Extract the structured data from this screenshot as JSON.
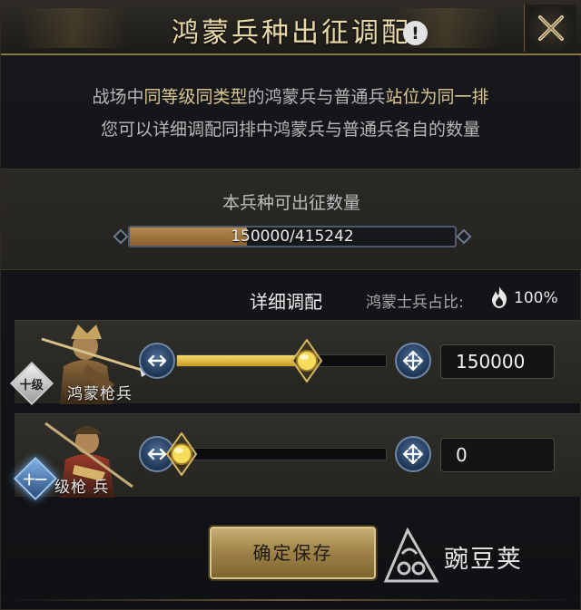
{
  "header": {
    "title": "鸿蒙兵种出征调配"
  },
  "info": {
    "line1": {
      "a": "战场中",
      "b": "同等级同类型",
      "c": "的鸿蒙兵与普通兵",
      "d": "站位为同一排"
    },
    "line2": "您可以详细调配同排中鸿蒙兵与普通兵各自的数量"
  },
  "quantity": {
    "label": "本兵种可出征数量",
    "text": "150000/415242",
    "current": 150000,
    "max": 415242
  },
  "detail": {
    "title": "详细调配",
    "ratio_label": "鸿蒙士兵占比:",
    "ratio_value": "100%"
  },
  "units": [
    {
      "level": "十级",
      "name": "鸿蒙枪兵",
      "value": "150000",
      "fraction": 0.62
    },
    {
      "level": "十一",
      "name": "级枪 兵",
      "value": "0",
      "fraction": 0.0
    }
  ],
  "confirm_label": "确定保存",
  "watermark": "豌豆荚",
  "colors": {
    "accent_gold": "#c8ae74",
    "bar_fill": "#b48a51",
    "slider_fill": "#f3da6b"
  }
}
